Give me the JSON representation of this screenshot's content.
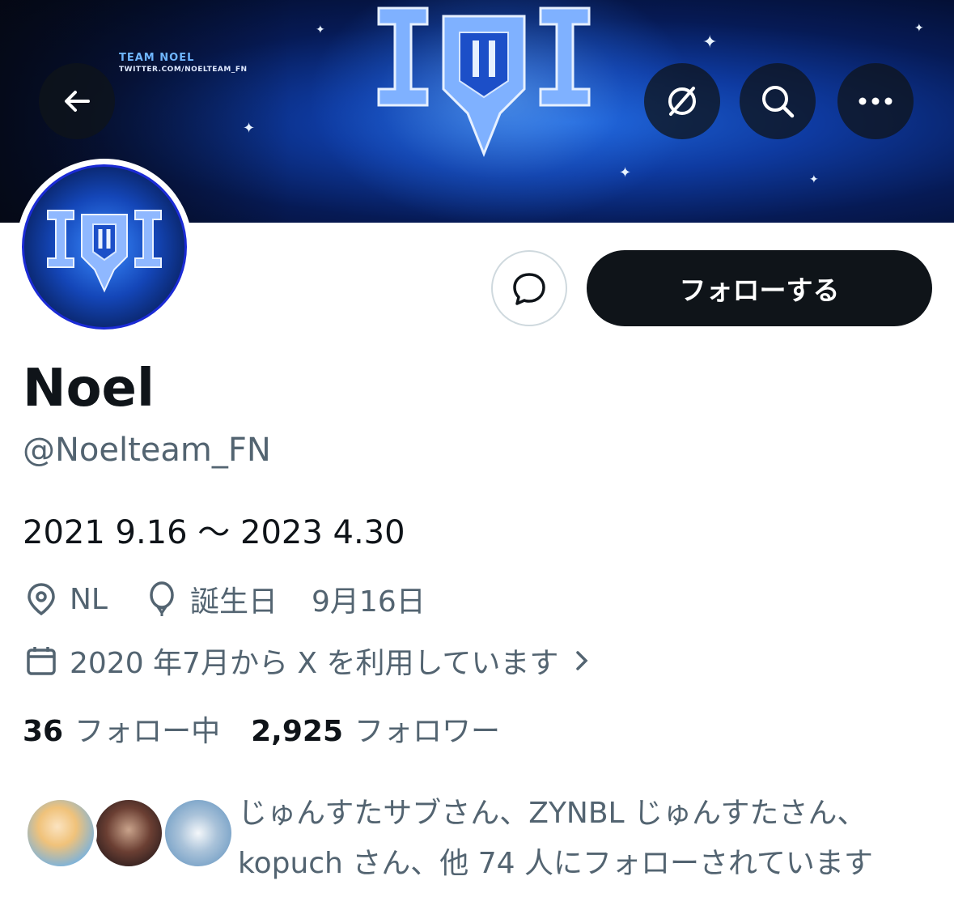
{
  "banner": {
    "team_text": "TEAM NOEL",
    "url_text": "TWITTER.COM/NOELTEAM_FN"
  },
  "top_actions": {
    "back_icon": "arrow-left-icon",
    "grok_icon": "slashed-circle-icon",
    "search_icon": "search-icon",
    "more_icon": "more-horizontal-icon"
  },
  "profile": {
    "name": "Noel",
    "handle": "@Noelteam_FN",
    "bio": "2021 9.16 〜 2023 4.30",
    "location": "NL",
    "birthday_label": "誕生日",
    "birthday": "9月16日",
    "joined": "2020 年7月から X を利用しています"
  },
  "buttons": {
    "follow_label": "フォローする",
    "dm_icon": "message-bubble-icon"
  },
  "stats": {
    "following_count": "36",
    "following_label": "フォロー中",
    "followers_count": "2,925",
    "followers_label": "フォロワー"
  },
  "followed_by": {
    "text": "じゅんすたサブさん、ZYNBL じゅんすたさん、kopuch さん、他 74 人にフォローされています"
  },
  "colors": {
    "primary_text": "#0f1419",
    "secondary_text": "#536471",
    "follow_button_bg": "#0f1419",
    "banner_blue": "#1d63d8"
  }
}
